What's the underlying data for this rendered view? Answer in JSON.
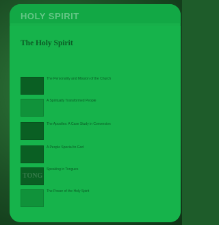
{
  "header": {
    "top_text": "",
    "brand_word": "HOLY SPIRIT"
  },
  "main": {
    "breadcrumb": "",
    "title": "The Holy Spirit",
    "intro_1": "",
    "intro_2": ""
  },
  "items": [
    {
      "title": "The Personality and Mission of the Church",
      "meta": "",
      "desc": "",
      "thumb_text": ""
    },
    {
      "title": "A Spiritually Transformed People",
      "meta": "",
      "desc": "",
      "thumb_text": ""
    },
    {
      "title": "The Apostles: A Case Study in Conversion",
      "meta": "",
      "desc": "",
      "thumb_text": ""
    },
    {
      "title": "A People Special to God",
      "meta": "",
      "desc": "",
      "thumb_text": ""
    },
    {
      "title": "Speaking in Tongues",
      "meta": "",
      "desc": "",
      "thumb_text": "TONGUES"
    },
    {
      "title": "The Power of the Holy Spirit",
      "meta": "",
      "desc": "",
      "thumb_text": ""
    }
  ]
}
